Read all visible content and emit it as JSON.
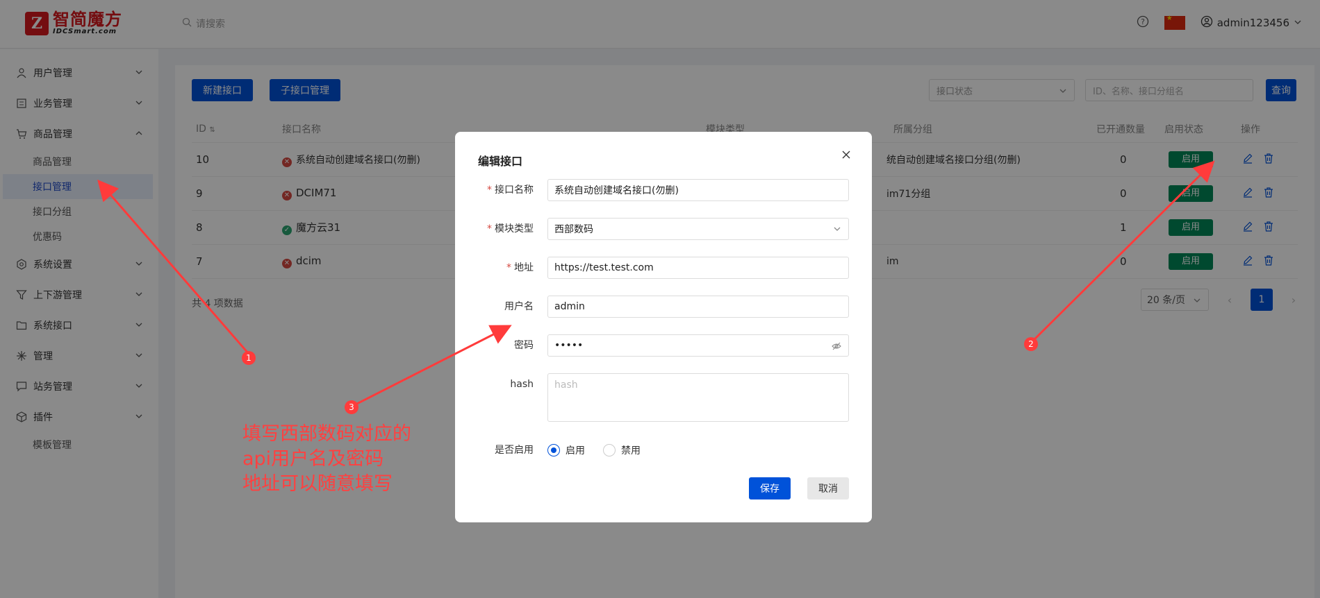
{
  "header": {
    "logo_mark": "Z",
    "logo_cn": "智简魔方",
    "logo_en": "IDCSmart.com",
    "search_placeholder": "请搜索",
    "username": "admin123456"
  },
  "sidebar": {
    "items": [
      {
        "label": "用户管理",
        "icon": "user-icon",
        "expanded": false
      },
      {
        "label": "业务管理",
        "icon": "list-icon",
        "expanded": false
      },
      {
        "label": "商品管理",
        "icon": "cart-icon",
        "expanded": true,
        "children": [
          "商品管理",
          "接口管理",
          "接口分组",
          "优惠码"
        ],
        "active_child": 1
      },
      {
        "label": "系统设置",
        "icon": "settings-icon",
        "expanded": false
      },
      {
        "label": "上下游管理",
        "icon": "filter-icon",
        "expanded": false
      },
      {
        "label": "系统接口",
        "icon": "folder-icon",
        "expanded": false
      },
      {
        "label": "管理",
        "icon": "asterisk-icon",
        "expanded": false
      },
      {
        "label": "站务管理",
        "icon": "message-icon",
        "expanded": false
      },
      {
        "label": "插件",
        "icon": "cube-icon",
        "expanded": false
      },
      {
        "label": "模板管理",
        "icon": "",
        "expanded": false
      }
    ]
  },
  "toolbar": {
    "new_button": "新建接口",
    "sub_button": "子接口管理",
    "status_placeholder": "接口状态",
    "search_placeholder": "ID、名称、接口分组名",
    "query_button": "查询"
  },
  "table": {
    "headers": [
      "ID",
      "接口名称",
      "模块类型",
      "所属分组",
      "已开通数量",
      "启用状态",
      "操作"
    ],
    "rows": [
      {
        "id": "10",
        "name": "系统自动创建域名接口(勿删)",
        "ok": false,
        "group": "统自动创建域名接口分组(勿删)",
        "count": "0",
        "status": "启用"
      },
      {
        "id": "9",
        "name": "DCIM71",
        "ok": false,
        "group": "im71分组",
        "count": "0",
        "status": "启用"
      },
      {
        "id": "8",
        "name": "魔方云31",
        "ok": true,
        "group": "",
        "count": "1",
        "status": "启用"
      },
      {
        "id": "7",
        "name": "dcim",
        "ok": false,
        "group": "im",
        "count": "0",
        "status": "启用"
      }
    ],
    "total": "共 4 项数据",
    "page_size": "20 条/页",
    "current_page": "1"
  },
  "modal": {
    "title": "编辑接口",
    "fields": {
      "name_label": "接口名称",
      "name_value": "系统自动创建域名接口(勿删)",
      "module_label": "模块类型",
      "module_value": "西部数码",
      "address_label": "地址",
      "address_value": "https://test.test.com",
      "username_label": "用户名",
      "username_value": "admin",
      "password_label": "密码",
      "password_value": "•••••",
      "hash_label": "hash",
      "hash_placeholder": "hash",
      "enable_label": "是否启用",
      "enable_on": "启用",
      "enable_off": "禁用"
    },
    "save": "保存",
    "cancel": "取消"
  },
  "annotations": {
    "note_line1": "填写西部数码对应的",
    "note_line2": "api用户名及密码",
    "note_line3": "地址可以随意填写",
    "badge1": "1",
    "badge2": "2",
    "badge3": "3",
    "arrow_color": "#ff3b3b"
  },
  "colors": {
    "primary": "#0052d9",
    "success_tag": "#008858",
    "error_dot": "#d54941",
    "ok_dot": "#2ba471",
    "brand_red": "#d7191e"
  }
}
